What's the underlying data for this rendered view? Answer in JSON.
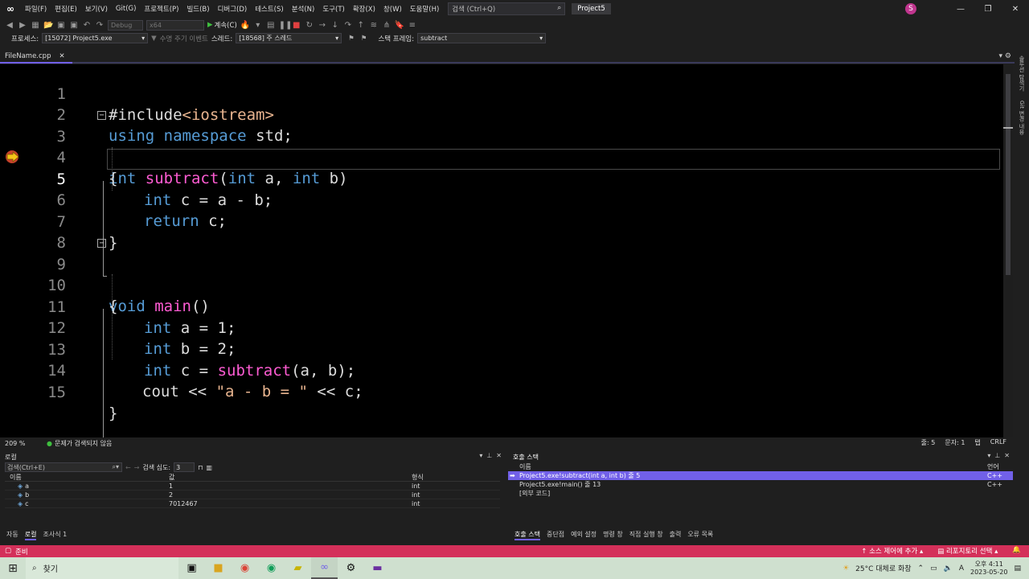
{
  "menu": {
    "items": [
      "파일(F)",
      "편집(E)",
      "보기(V)",
      "Git(G)",
      "프로젝트(P)",
      "빌드(B)",
      "디버그(D)",
      "테스트(S)",
      "분석(N)",
      "도구(T)",
      "확장(X)",
      "창(W)",
      "도움말(H)"
    ],
    "search_placeholder": "검색 (Ctrl+Q)",
    "project_name": "Project5",
    "avatar_letter": "S"
  },
  "toolbar": {
    "config": "Debug",
    "platform": "x64",
    "continue_label": "계속(C)"
  },
  "location": {
    "process_label": "프로세스:",
    "process_value": "[15072] Project5.exe",
    "lifecycle_label": "수명 주기 이벤트",
    "thread_label": "스레드:",
    "thread_value": "[18568] 주 스레드",
    "frame_label": "스택 프레임:",
    "frame_value": "subtract"
  },
  "editor": {
    "tab_name": "FileName.cpp",
    "current_line": 5,
    "zoom": "209 %",
    "issues": "문제가 검색되지 않음",
    "line_info": "줄: 5",
    "char_info": "문자: 1",
    "tab_info": "탭",
    "eol": "CRLF",
    "lines": [
      {
        "n": "1",
        "t": "#include<iostream>"
      },
      {
        "n": "2",
        "t": "using namespace std;"
      },
      {
        "n": "3",
        "t": "int subtract(int a, int b)"
      },
      {
        "n": "4",
        "t": "{"
      },
      {
        "n": "5",
        "t": "int c = a - b;"
      },
      {
        "n": "6",
        "t": "return c;"
      },
      {
        "n": "7",
        "t": "}"
      },
      {
        "n": "8",
        "t": ""
      },
      {
        "n": "9",
        "t": "void main()"
      },
      {
        "n": "10",
        "t": "{"
      },
      {
        "n": "11",
        "t": "int a = 1;"
      },
      {
        "n": "12",
        "t": "int b = 2;"
      },
      {
        "n": "13",
        "t": "int c = subtract(a, b);"
      },
      {
        "n": "14",
        "t": "cout << \"a - b = \" << c;"
      },
      {
        "n": "15",
        "t": "}"
      }
    ]
  },
  "vsidebar": {
    "label1": "솔루션 탐색기",
    "label2": "Git 변경 내용"
  },
  "locals": {
    "title": "로컬",
    "search_placeholder": "검색(Ctrl+E)",
    "depth_label": "검색 심도:",
    "depth_value": "3",
    "columns": {
      "name": "이름",
      "value": "값",
      "type": "형식"
    },
    "rows": [
      {
        "name": "a",
        "value": "1",
        "type": "int"
      },
      {
        "name": "b",
        "value": "2",
        "type": "int"
      },
      {
        "name": "c",
        "value": "7012467",
        "type": "int"
      }
    ],
    "tabs": [
      "자동",
      "로컬",
      "조사식 1"
    ]
  },
  "callstack": {
    "title": "호출 스택",
    "columns": {
      "name": "이름",
      "lang": "언어"
    },
    "rows": [
      {
        "frame": "Project5.exe!subtract(int a, int b) 줄 5",
        "lang": "C++"
      },
      {
        "frame": "Project5.exe!main() 줄 13",
        "lang": "C++"
      },
      {
        "frame": "[외부 코드]",
        "lang": ""
      }
    ],
    "tabs": [
      "호출 스택",
      "중단점",
      "예외 설정",
      "명령 창",
      "직접 실행 창",
      "출력",
      "오류 목록"
    ]
  },
  "statusbar": {
    "ready": "준비",
    "source_control": "소스 제어에 추가",
    "repo": "리포지토리 선택"
  },
  "taskbar": {
    "search_label": "찾기",
    "weather": "25°C 대체로 화창",
    "ime": "A",
    "time": "오후 4:11",
    "date": "2023-05-20"
  },
  "colors": {
    "accent": "#7160e8",
    "status_bar": "#d4305a",
    "keyword": "#569cd6",
    "function": "#ff5cd3",
    "string": "#e8b48f"
  }
}
